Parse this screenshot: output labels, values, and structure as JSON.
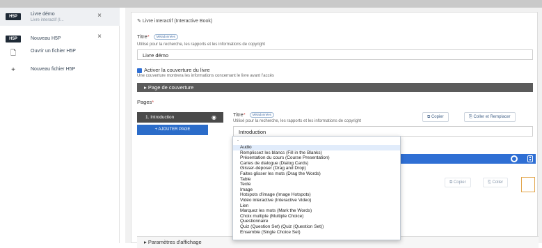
{
  "sidebar": {
    "items": [
      {
        "badge": "H5P",
        "title": "Livre démo",
        "subtitle": "Livre interactif (I...",
        "close": "×"
      },
      {
        "badge": "H5P",
        "title": "Nouveau H5P",
        "close": "×"
      },
      {
        "icon": "🗋",
        "title": "Ouvrir un fichier H5P"
      },
      {
        "icon": "+",
        "title": "Nouveau fichier H5P"
      }
    ]
  },
  "editor": {
    "content_type": "Livre interactif (Interactive Book)",
    "title_label": "Titre",
    "title_pill": "Métadonnées",
    "title_desc": "Utilisé pour la recherche, les rapports et les informations de copyright",
    "title_value": "Livre démo",
    "cover_check_label": "Activer la couverture du livre",
    "cover_desc": "Une couverture montrera les informations concernant le livre avant l'accès",
    "cover_section": "Page de couverture",
    "pages_label": "Pages",
    "page_item": "1. Introduction",
    "add_page": "+ AJOUTER PAGE",
    "page_title_label": "Titre",
    "page_title_pill": "Métadonnées",
    "page_title_desc": "Utilisé pour la recherche, les rapports et les informations de copyright",
    "page_title_value": "Introduction",
    "copy_btn": "Copier",
    "paste_replace_btn": "Coller et Remplacer",
    "copy_btn_2": "Copier",
    "paste_btn_2": "Coller",
    "settings_section": "Paramètres d'affichage"
  },
  "dropdown": {
    "header": "-",
    "options": [
      "Audio",
      "Remplissez les blancs (Fill in the Blanks)",
      "Présentation du cours (Course Presentation)",
      "Cartes de dialogue (Dialog Cards)",
      "Glisser-déposer (Drag and Drop)",
      "Faites glisser les mots (Drag the Words)",
      "Table",
      "Texte",
      "Image",
      "Hotspots d'image (Image Hotspots)",
      "Vidéo interactive (Interactive Video)",
      "Lien",
      "Marquez les mots (Mark the Words)",
      "Choix multiple (Multiple Choice)",
      "Questionnaire",
      "Quiz (Question Set) (Quiz (Question Set))",
      "Ensemble (Single Choice Set)"
    ],
    "selected_index": 0
  },
  "colors": {
    "accent": "#2f6fd4",
    "dark": "#4a4a4a",
    "badge": "#1f2a36",
    "required": "#d9534f"
  }
}
